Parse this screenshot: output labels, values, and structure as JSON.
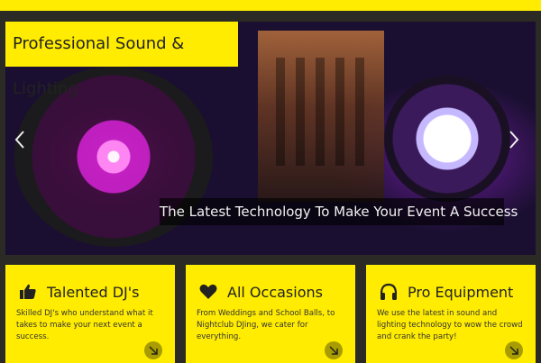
{
  "slider": {
    "title": "Professional Sound & Lighting",
    "caption": "The Latest Technology To Make Your Event A Success"
  },
  "cards": [
    {
      "title": "Talented DJ's",
      "icon": "thumbs-up-icon",
      "text": "Skilled DJ's who understand what it takes to make your next event a success."
    },
    {
      "title": "All Occasions",
      "icon": "heart-icon",
      "text": "From Weddings and School Balls, to Nightclub DJing, we cater for everything."
    },
    {
      "title": "Pro Equipment",
      "icon": "headphones-icon",
      "text": "We use the latest in sound and lighting technology to wow the crowd and crank the party!"
    }
  ],
  "colors": {
    "accent": "#ffec00",
    "background": "#2b2a24"
  }
}
